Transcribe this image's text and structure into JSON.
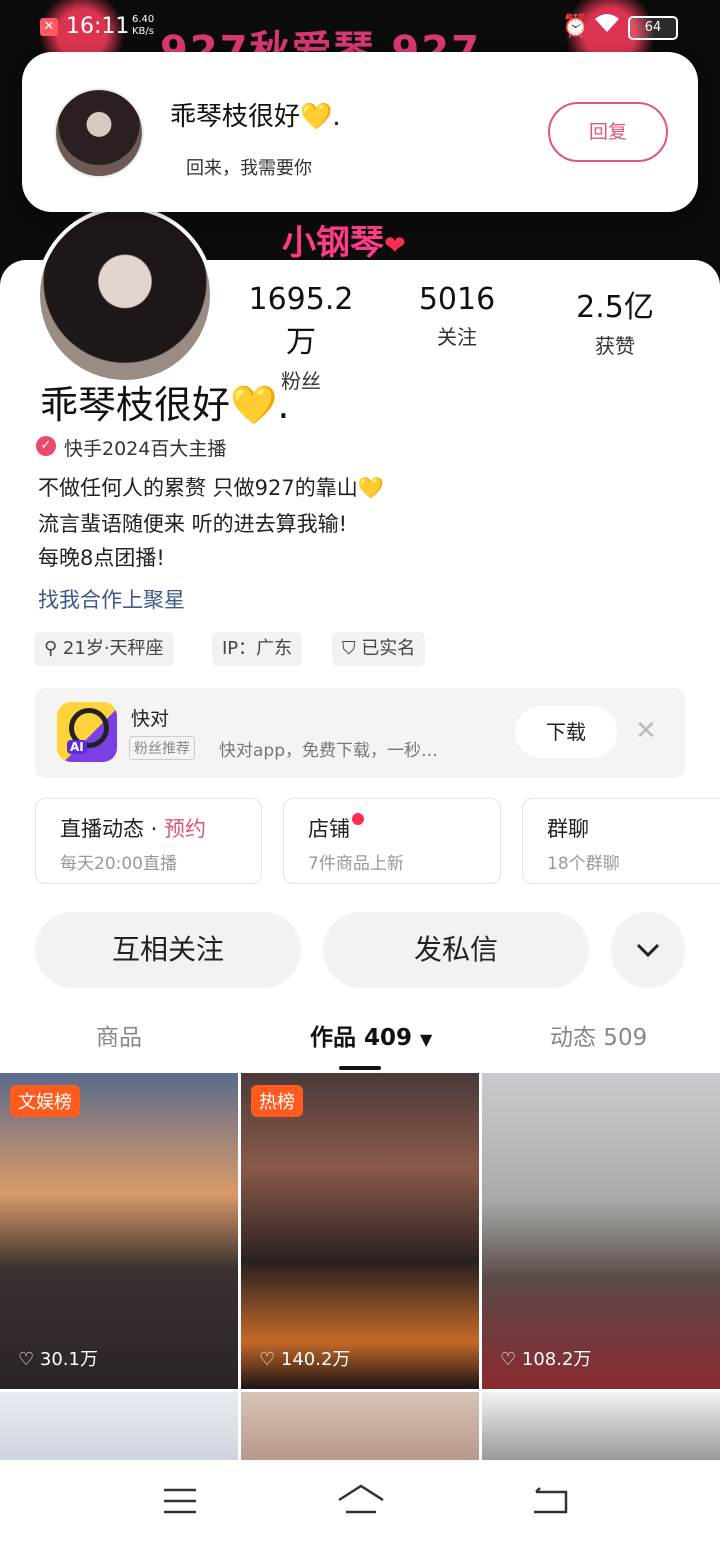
{
  "status_bar": {
    "time": "16:11",
    "speed": "6.40\nKB/s",
    "battery": "64"
  },
  "banner": {
    "text": "927秋爱琴 927",
    "subtitle": "小钢琴"
  },
  "notification": {
    "name": "乖琴枝很好💛.",
    "message": "回来，我需要你",
    "reply_label": "回复"
  },
  "profile": {
    "stats": [
      {
        "value": "1695.2万",
        "label": "粉丝"
      },
      {
        "value": "5016",
        "label": "关注"
      },
      {
        "value": "2.5亿",
        "label": "获赞"
      }
    ],
    "name": "乖琴枝很好💛.",
    "badge_text": "快手2024百大主播",
    "bio_lines": [
      "不做任何人的累赘 只做927的靠山💛",
      "流言蜚语随便来 听的进去算我输!",
      "每晚8点团播!"
    ],
    "link": "找我合作上聚星",
    "tags": [
      "21岁·天秤座",
      "IP：广东",
      "已实名"
    ]
  },
  "ad": {
    "title": "快对",
    "chip": "粉丝推荐",
    "desc": "快对app，免费下载，一秒…",
    "download_label": "下载",
    "logo_text": "AI"
  },
  "cards": [
    {
      "title": "直播动态",
      "suffix": "预约",
      "sub": "每天20:00直播"
    },
    {
      "title": "店铺",
      "sub": "7件商品上新"
    },
    {
      "title": "群聊",
      "sub": "18个群聊"
    }
  ],
  "actions": {
    "follow": "互相关注",
    "message": "发私信"
  },
  "tabs": [
    {
      "label": "商品"
    },
    {
      "label": "作品 409"
    },
    {
      "label": "动态 509"
    }
  ],
  "grid": [
    {
      "badge": "文娱榜",
      "likes": "30.1万"
    },
    {
      "badge": "热榜",
      "likes": "140.2万"
    },
    {
      "badge": "",
      "likes": "108.2万"
    }
  ],
  "colors": {
    "accent": "#e2567a",
    "link": "#3c5a8a",
    "badge": "#ff5b1f"
  }
}
